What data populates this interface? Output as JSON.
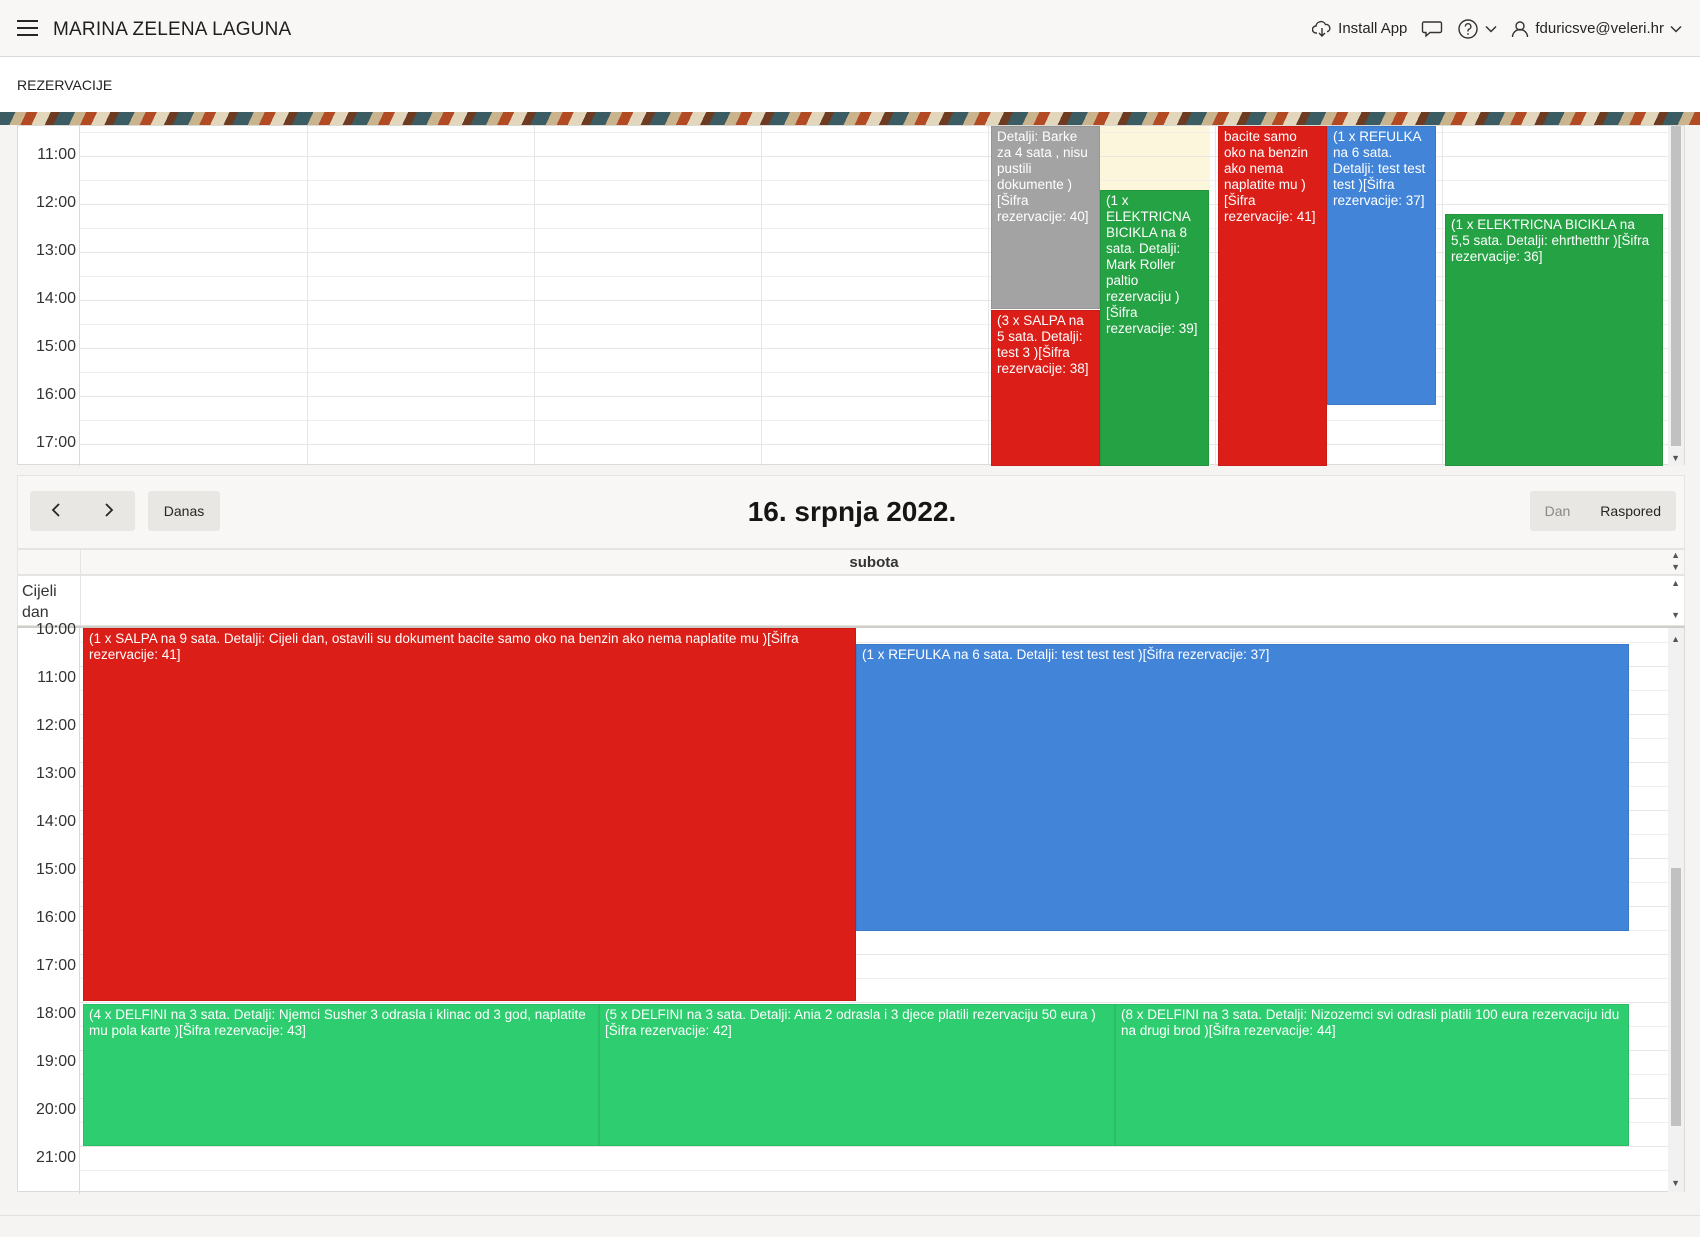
{
  "app": {
    "title": "MARINA ZELENA LAGUNA",
    "install_label": "Install App",
    "user": "fduricsve@veleri.hr"
  },
  "breadcrumb": "REZERVACIJE",
  "colors": {
    "red": "#db1f18",
    "blue": "#4285d8",
    "green_dark": "#25a243",
    "green": "#2ecd6f",
    "grey": "#a3a3a3"
  },
  "top_calendar": {
    "times": [
      "11:00",
      "12:00",
      "13:00",
      "14:00",
      "15:00",
      "16:00",
      "17:00"
    ],
    "events": [
      {
        "text": "Detalji: Barke za 4 sata , nisu pustili dokumente )[Šifra rezervacije: 40]",
        "color": "grey"
      },
      {
        "text": "(3 x SALPA na 5 sata. Detalji: test 3 )[Šifra rezervacije: 38]",
        "color": "red"
      },
      {
        "text": "(1 x ELEKTRICNA BICIKLA na 8 sata. Detalji: Mark Roller paltio rezervaciju )[Šifra rezervacije: 39]",
        "color": "green_dark"
      },
      {
        "text": "bacite samo oko na benzin ako nema naplatite mu )[Šifra rezervacije: 41]",
        "color": "red"
      },
      {
        "text": "(1 x REFULKA na 6 sata. Detalji: test test test )[Šifra rezervacije: 37]",
        "color": "blue"
      },
      {
        "text": "(1 x ELEKTRICNA BICIKLA na 5,5 sata. Detalji: ehrthetthr )[Šifra rezervacije: 36]",
        "color": "green_dark"
      }
    ]
  },
  "toolbar": {
    "prev_icon": "chevron-left-icon",
    "next_icon": "chevron-right-icon",
    "today_label": "Danas",
    "date_title": "16. srpnja 2022.",
    "view_day": "Dan",
    "view_schedule": "Raspored"
  },
  "day_view": {
    "day_name": "subota",
    "allday_label": "Cijeli dan",
    "times": [
      "10:00",
      "11:00",
      "12:00",
      "13:00",
      "14:00",
      "15:00",
      "16:00",
      "17:00",
      "18:00",
      "19:00",
      "20:00",
      "21:00"
    ],
    "events": [
      {
        "text": "(1 x SALPA na 9 sata. Detalji: Cijeli dan, ostavili su dokument bacite samo oko na benzin ako nema naplatite mu )[Šifra rezervacije: 41]",
        "color": "red"
      },
      {
        "text": "(1 x REFULKA na 6 sata. Detalji: test test test )[Šifra rezervacije: 37]",
        "color": "blue"
      },
      {
        "text": "(4 x DELFINI na 3 sata. Detalji: Njemci Susher 3 odrasla i klinac od 3 god, naplatite mu pola karte )[Šifra rezervacije: 43]",
        "color": "green"
      },
      {
        "text": "(5 x DELFINI na 3 sata. Detalji: Ania 2 odrasla i 3 djece platili rezervaciju 50 eura )[Šifra rezervacije: 42]",
        "color": "green"
      },
      {
        "text": "(8 x DELFINI na 3 sata. Detalji: Nizozemci svi odrasli platili 100 eura rezervaciju idu na drugi brod )[Šifra rezervacije: 44]",
        "color": "green"
      }
    ]
  }
}
